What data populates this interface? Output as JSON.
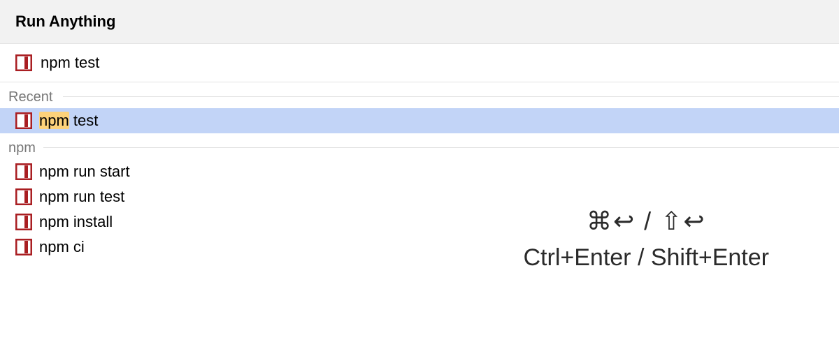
{
  "header": {
    "title": "Run Anything"
  },
  "query": {
    "text": "npm test"
  },
  "sections": {
    "recent": {
      "label": "Recent",
      "items": [
        {
          "prefix": "npm",
          "rest": " test",
          "highlighted": true,
          "selected": true
        }
      ]
    },
    "npm": {
      "label": "npm",
      "items": [
        {
          "text": "npm run start"
        },
        {
          "text": "npm run test"
        },
        {
          "text": "npm install"
        },
        {
          "text": "npm ci"
        }
      ]
    }
  },
  "shortcut": {
    "symbols": "⌘↩ / ⇧↩",
    "text": "Ctrl+Enter / Shift+Enter"
  }
}
